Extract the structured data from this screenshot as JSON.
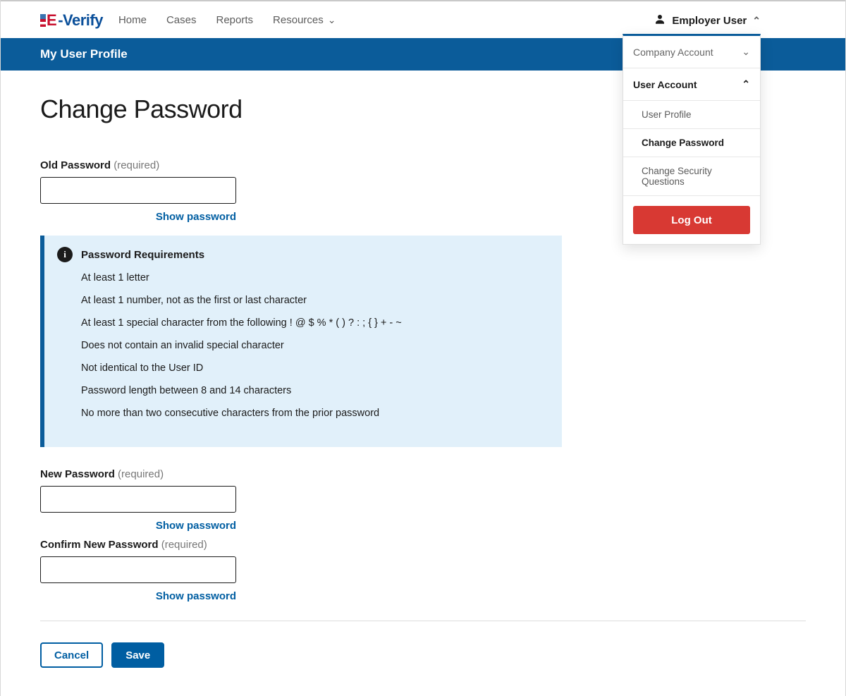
{
  "brand": {
    "letter_e": "E",
    "rest": "Verify"
  },
  "nav": {
    "home": "Home",
    "cases": "Cases",
    "reports": "Reports",
    "resources": "Resources"
  },
  "user_menu": {
    "trigger": "Employer User",
    "company_account": "Company Account",
    "user_account": "User Account",
    "items": {
      "profile": "User Profile",
      "change_password": "Change Password",
      "security_questions": "Change Security Questions"
    },
    "log_out": "Log Out"
  },
  "stripe_title": "My User Profile",
  "page_title": "Change Password",
  "fields": {
    "old": {
      "label": "Old Password",
      "req": "(required)",
      "show": "Show password"
    },
    "new": {
      "label": "New Password",
      "req": "(required)",
      "show": "Show password"
    },
    "confirm": {
      "label": "Confirm New Password",
      "req": "(required)",
      "show": "Show password"
    }
  },
  "requirements": {
    "title": "Password Requirements",
    "items": [
      "At least 1 letter",
      "At least 1 number, not as the first or last character",
      "At least 1 special character from the following ! @ $ % * ( ) ? : ; { } + - ~",
      "Does not contain an invalid special character",
      "Not identical to the User ID",
      "Password length between 8 and 14 characters",
      "No more than two consecutive characters from the prior password"
    ]
  },
  "buttons": {
    "cancel": "Cancel",
    "save": "Save"
  }
}
